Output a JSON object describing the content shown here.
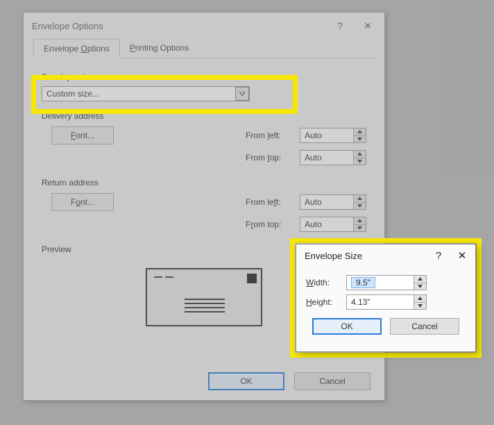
{
  "main_dialog": {
    "title": "Envelope Options",
    "help_symbol": "?",
    "close_symbol": "✕",
    "tabs": {
      "envelope_options": "Envelope Options",
      "envelope_options_ul": "O",
      "printing_options": "Printing Options",
      "printing_options_ul": "P"
    },
    "envelope_size_label": "Envelope size:",
    "envelope_size_ul": "s",
    "envelope_size_value": "Custom size...",
    "delivery_label": "Delivery address",
    "return_label": "Return address",
    "font_button": "Font...",
    "font_button_ul": "F",
    "font_button2_ul": "o",
    "from_left": "From left:",
    "from_left_ul": "l",
    "from_top": "From top:",
    "from_top_ul": "t",
    "auto": "Auto",
    "preview_label": "Preview",
    "ok": "OK",
    "cancel": "Cancel"
  },
  "sub_dialog": {
    "title": "Envelope Size",
    "help_symbol": "?",
    "close_symbol": "✕",
    "width_label": "Width:",
    "width_ul": "W",
    "width_value": "9.5\"",
    "height_label": "Height:",
    "height_ul": "H",
    "height_value": "4.13\"",
    "ok": "OK",
    "cancel": "Cancel"
  }
}
